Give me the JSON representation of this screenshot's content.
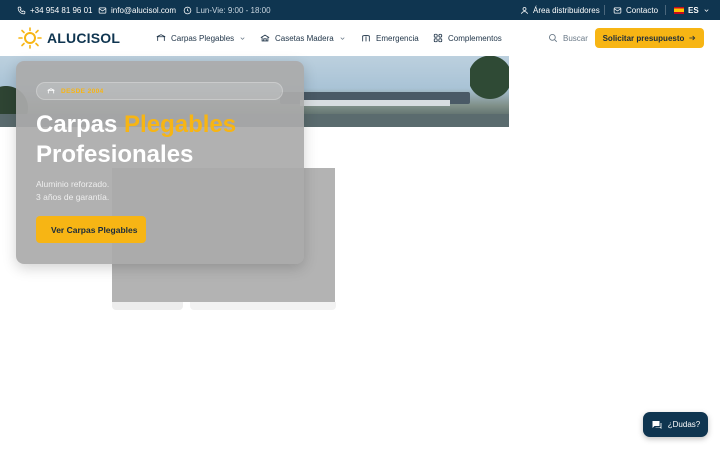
{
  "topbar": {
    "phone": "+34 954 81 96 01",
    "email": "info@alucisol.com",
    "hours": "Lun-Vie: 9:00 - 18:00",
    "distributors": "Área distribuidores",
    "contact": "Contacto",
    "language": "ES"
  },
  "nav": {
    "logo": "ALUCISOL",
    "items": [
      {
        "label": "Carpas Plegables",
        "icon": "canopy-icon",
        "dropdown": true
      },
      {
        "label": "Casetas Madera",
        "icon": "hut-icon",
        "dropdown": true
      },
      {
        "label": "Emergencia",
        "icon": "tent-icon",
        "dropdown": false
      },
      {
        "label": "Complementos",
        "icon": "grid-icon",
        "dropdown": false
      }
    ],
    "search_label": "Buscar",
    "cta_label": "Solicitar presupuesto"
  },
  "hero": {
    "badge": "DESDE 2004",
    "title_white": "Carpas",
    "title_accent": "Plegables",
    "title_line2": "Profesionales",
    "desc_line1": "Aluminio reforzado.",
    "desc_line2": "3 años de garantía.",
    "button_label": "Ver Carpas Plegables"
  },
  "chat": {
    "label": "¿Dudas?"
  },
  "colors": {
    "primary": "#0f3550",
    "accent": "#f7b514"
  }
}
